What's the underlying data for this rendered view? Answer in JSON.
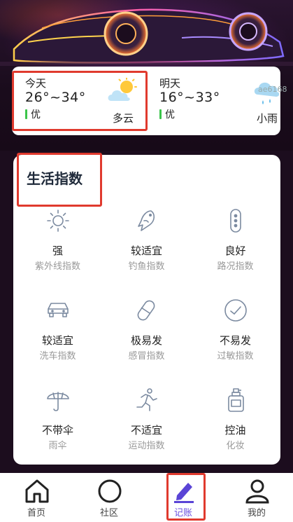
{
  "weather": {
    "today": {
      "label": "今天",
      "temp": "26°~34°",
      "aqi": "优",
      "condition": "多云",
      "icon": "partly-cloudy-icon"
    },
    "tomorrow": {
      "label": "明天",
      "temp": "16°~33°",
      "aqi": "优",
      "condition": "小雨",
      "icon": "light-rain-icon"
    },
    "watermark": "ae6168"
  },
  "life": {
    "title": "生活指数",
    "items": [
      {
        "value": "强",
        "name": "紫外线指数",
        "icon": "sun-icon"
      },
      {
        "value": "较适宜",
        "name": "钓鱼指数",
        "icon": "fish-icon"
      },
      {
        "value": "良好",
        "name": "路况指数",
        "icon": "traffic-light-icon"
      },
      {
        "value": "较适宜",
        "name": "洗车指数",
        "icon": "car-icon"
      },
      {
        "value": "极易发",
        "name": "感冒指数",
        "icon": "pill-icon"
      },
      {
        "value": "不易发",
        "name": "过敏指数",
        "icon": "allergy-icon"
      },
      {
        "value": "不带伞",
        "name": "雨伞",
        "icon": "umbrella-icon"
      },
      {
        "value": "不适宜",
        "name": "运动指数",
        "icon": "running-icon"
      },
      {
        "value": "控油",
        "name": "化妆",
        "icon": "lotion-bottle-icon"
      }
    ]
  },
  "tabs": [
    {
      "label": "首页",
      "icon": "home-icon"
    },
    {
      "label": "社区",
      "icon": "circle-icon"
    },
    {
      "label": "记账",
      "icon": "pen-icon",
      "active": true
    },
    {
      "label": "我的",
      "icon": "user-icon"
    }
  ],
  "colors": {
    "accent": "#6a4fe0",
    "highlight": "#e03a2e",
    "aqi_good": "#3bc54a"
  }
}
